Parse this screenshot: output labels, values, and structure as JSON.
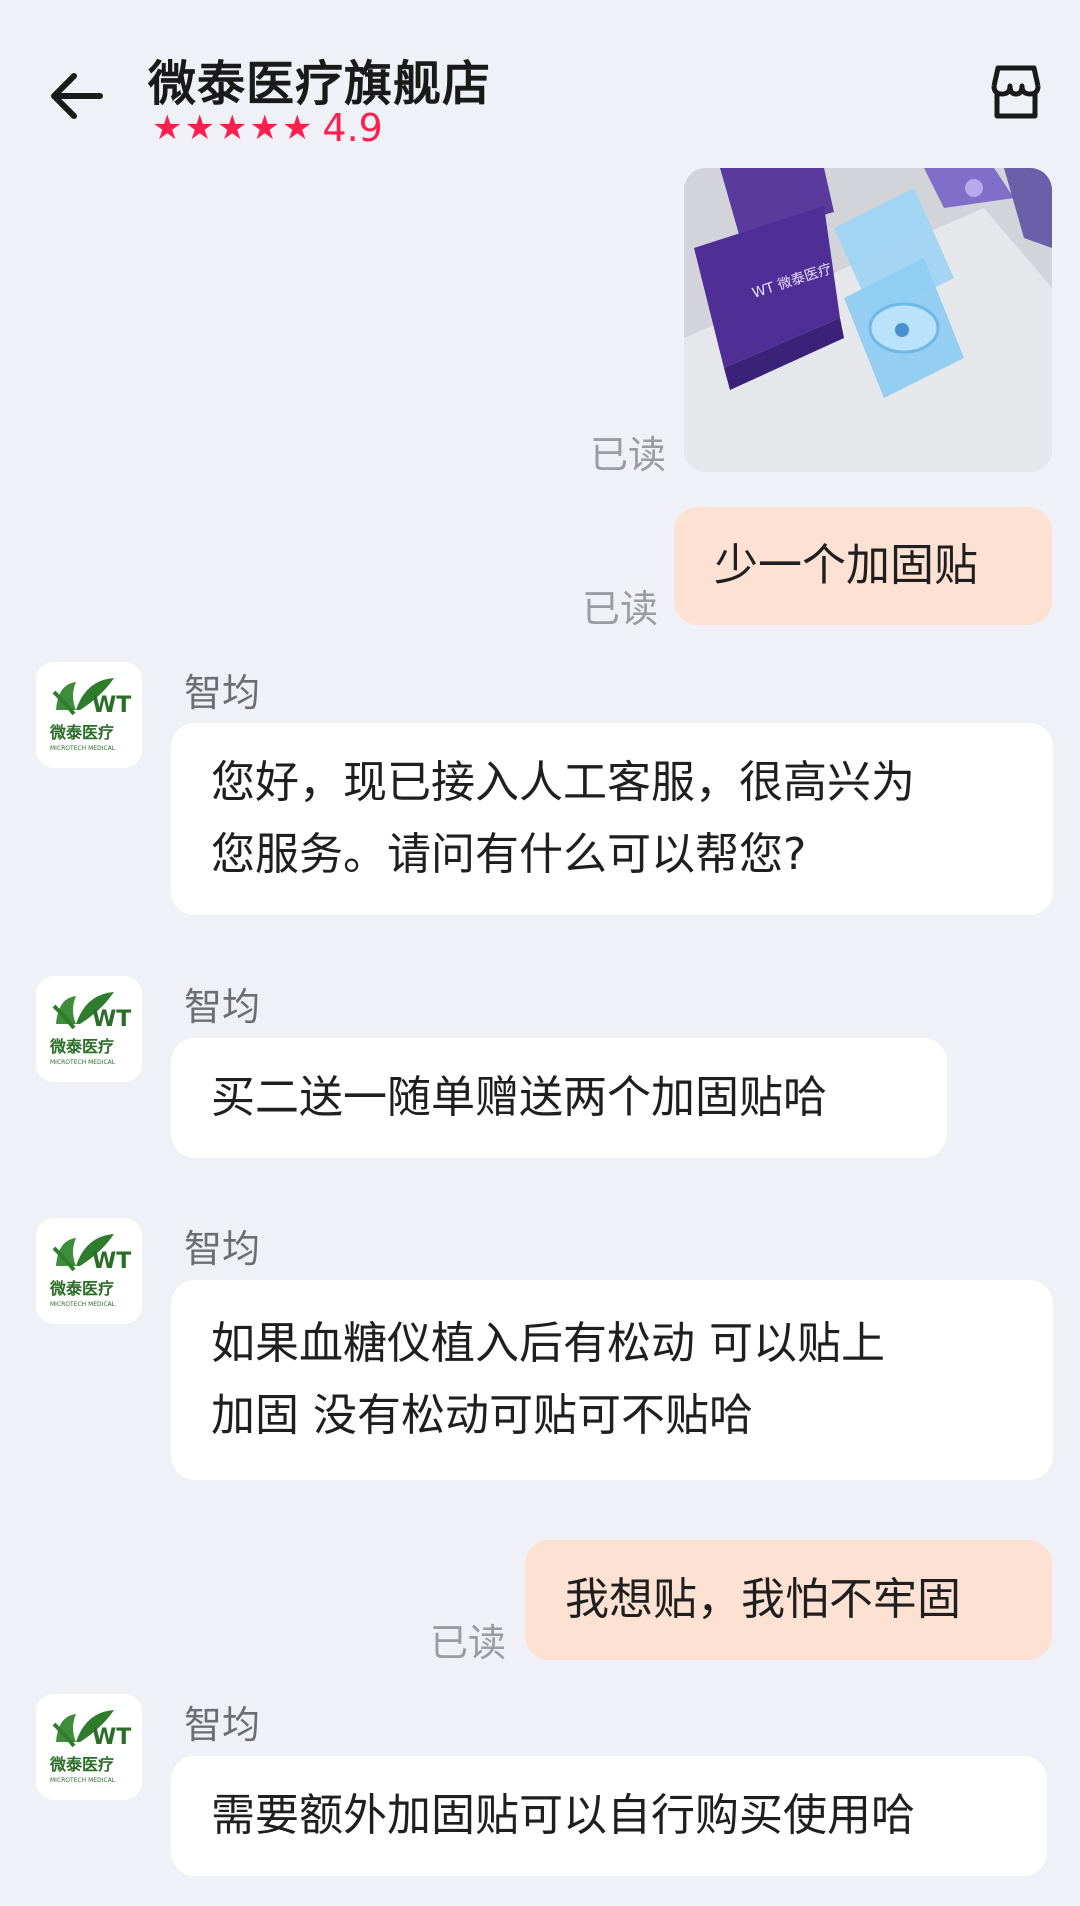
{
  "header": {
    "title": "微泰医疗旗舰店",
    "rating": "4.9",
    "stars": 5
  },
  "messages": [
    {
      "type": "image",
      "from": "me",
      "status": "已读"
    },
    {
      "type": "text",
      "from": "me",
      "text": "少一个加固贴",
      "status": "已读"
    },
    {
      "type": "text",
      "from": "agent",
      "sender": "智均",
      "lines": [
        "您好，现已接入人工客服，很高兴为",
        "您服务。请问有什么可以帮您?"
      ]
    },
    {
      "type": "text",
      "from": "agent",
      "sender": "智均",
      "lines": [
        "买二送一随单赠送两个加固贴哈"
      ]
    },
    {
      "type": "text",
      "from": "agent",
      "sender": "智均",
      "lines": [
        "如果血糖仪植入后有松动 可以贴上",
        "加固 没有松动可贴可不贴哈"
      ]
    },
    {
      "type": "text",
      "from": "me",
      "text": "我想贴，我怕不牢固",
      "status": "已读"
    },
    {
      "type": "text",
      "from": "agent",
      "sender": "智均",
      "lines": [
        "需要额外加固贴可以自行购买使用哈"
      ]
    }
  ],
  "avatar": {
    "logo_letters": "WT",
    "brand": "微泰医疗",
    "subtitle": "MICROTECH MEDICAL"
  },
  "colors": {
    "accent": "#ff1f4f",
    "outgoing_bubble": "#fde1d3",
    "incoming_bubble": "#ffffff",
    "background": "#eff1f6"
  }
}
